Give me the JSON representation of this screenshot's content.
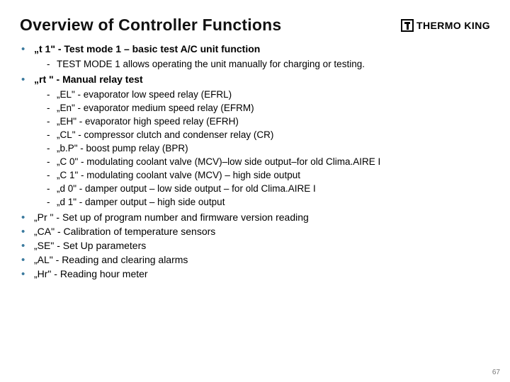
{
  "header": {
    "title": "Overview of Controller Functions",
    "brand": "THERMO KING"
  },
  "items": [
    {
      "label": "„t 1\" - Test mode 1 – basic test A/C unit function",
      "bold": true,
      "sub": [
        "TEST MODE 1 allows operating the unit manually for charging or testing."
      ]
    },
    {
      "label": "„rt \" - Manual relay test",
      "bold": true,
      "sub": [
        "„EL\" - evaporator low speed relay (EFRL)",
        "„En\" - evaporator medium speed relay (EFRM)",
        "„EH\" - evaporator high speed relay (EFRH)",
        "„CL\" - compressor clutch and condenser relay (CR)",
        "„b.P\" - boost pump relay (BPR)",
        "„C 0\" - modulating coolant valve (MCV)–low side output–for old Clima.AIRE I",
        "„C 1\" - modulating coolant valve (MCV) – high side output",
        "„d 0\" - damper output – low side output – for old Clima.AIRE I",
        "„d 1\" - damper output – high side output"
      ]
    },
    {
      "label": "„Pr \" - Set up of program number and firmware version reading",
      "bold": false
    },
    {
      "label": "„CA\" - Calibration of temperature sensors",
      "bold": false
    },
    {
      "label": "„SE\" - Set Up parameters",
      "bold": false
    },
    {
      "label": "„AL\" - Reading and clearing alarms",
      "bold": false
    },
    {
      "label": "„Hr\" - Reading hour meter",
      "bold": false
    }
  ],
  "page_number": "67"
}
